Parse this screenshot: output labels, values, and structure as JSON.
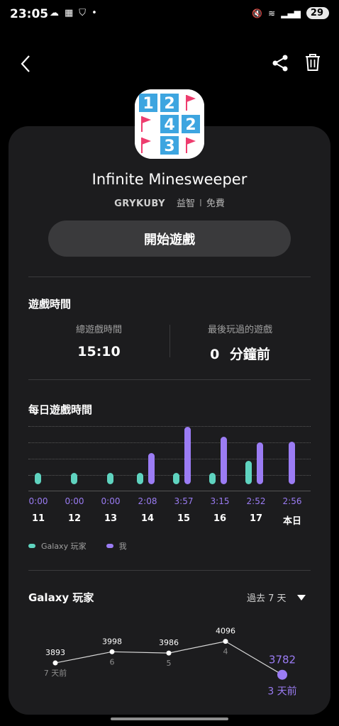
{
  "status_bar": {
    "time": "23:05",
    "battery": "29"
  },
  "app": {
    "name": "Infinite Minesweeper",
    "developer": "GRYKUBY",
    "category": "益智",
    "separator": "I",
    "price": "免費",
    "play_label": "開始遊戲"
  },
  "playtime": {
    "section_title": "遊戲時間",
    "total_label": "總遊戲時間",
    "total_value": "15:10",
    "last_label": "最後玩過的遊戲",
    "last_value": "0",
    "last_unit": "分鐘前"
  },
  "daily": {
    "section_title": "每日遊戲時間",
    "legend_galaxy": "Galaxy 玩家",
    "legend_me": "我",
    "colors": {
      "galaxy": "#5fd3bf",
      "me": "#9b7cf4"
    }
  },
  "galaxy": {
    "section_title": "Galaxy 玩家",
    "filter_label": "過去 7 天"
  },
  "chart_data": [
    {
      "type": "bar",
      "categories": [
        "11",
        "12",
        "13",
        "14",
        "15",
        "16",
        "17",
        "本日"
      ],
      "time_labels": [
        "0:00",
        "0:00",
        "0:00",
        "2:08",
        "3:57",
        "3:15",
        "2:52",
        "2:56"
      ],
      "series": [
        {
          "name": "Galaxy 玩家",
          "values": [
            0.8,
            0.8,
            0.8,
            0.8,
            0.8,
            0.8,
            1.6,
            0
          ]
        },
        {
          "name": "我",
          "values": [
            0,
            0,
            0,
            2.13,
            3.95,
            3.25,
            2.87,
            2.93
          ]
        }
      ],
      "ylim": [
        0,
        4
      ],
      "grid": true
    },
    {
      "type": "line",
      "categories": [
        "7 天前",
        "6",
        "5",
        "4",
        "3 天前"
      ],
      "values": [
        3893,
        3998,
        3986,
        4096,
        3782
      ]
    }
  ]
}
